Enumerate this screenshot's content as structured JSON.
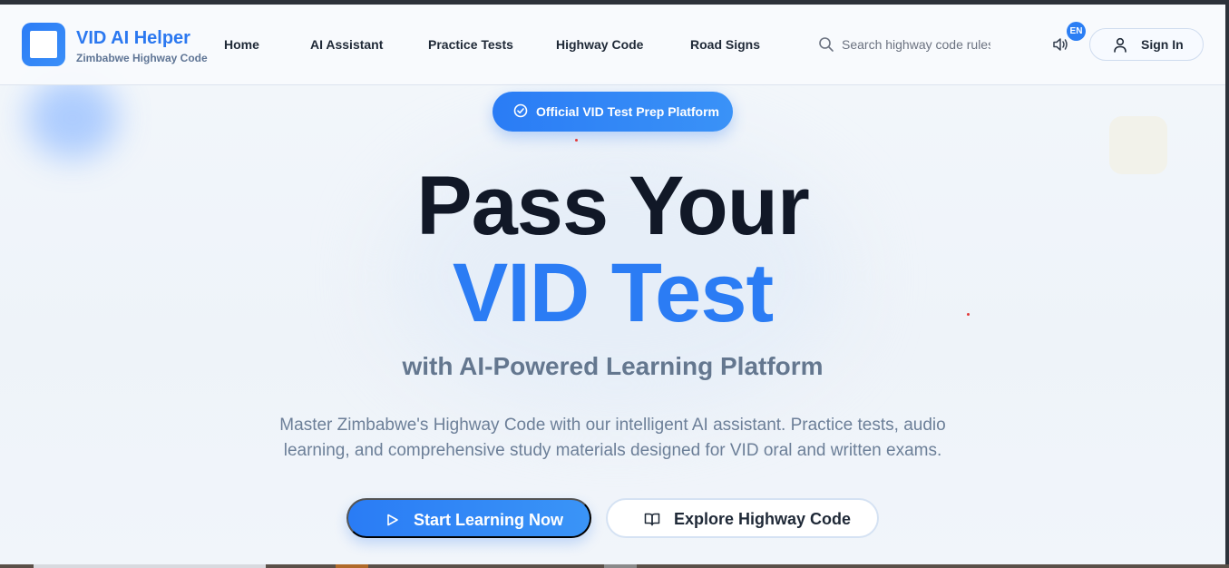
{
  "header": {
    "brand_title": "VID AI Helper",
    "brand_subtitle": "Zimbabwe Highway Code",
    "nav": [
      "Home",
      "AI Assistant",
      "Practice Tests",
      "Highway Code",
      "Road Signs"
    ],
    "search_placeholder": "Search highway code rules...",
    "language_badge": "EN",
    "signin_label": "Sign In"
  },
  "hero": {
    "badge_label": "Official VID Test Prep Platform",
    "title_line1": "Pass Your",
    "title_line2": "VID Test",
    "subtitle": "with AI-Powered Learning Platform",
    "description": "Master Zimbabwe's Highway Code with our intelligent AI assistant. Practice tests, audio learning, and comprehensive study materials designed for VID oral and written exams.",
    "primary_cta": "Start Learning Now",
    "secondary_cta": "Explore Highway Code"
  },
  "colors": {
    "accent": "#2b7cf4",
    "title_dark": "#111827",
    "subtitle_gray": "#64778f"
  }
}
